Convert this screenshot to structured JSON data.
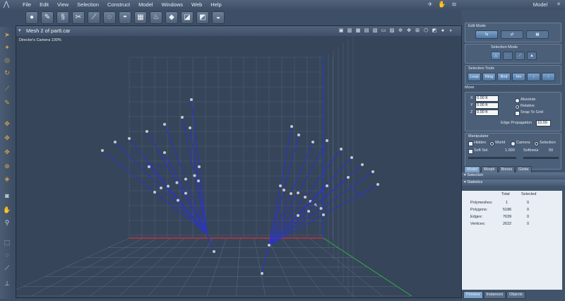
{
  "menubar": {
    "items": [
      "File",
      "Edit",
      "View",
      "Selection",
      "Construct",
      "Model",
      "Windows",
      "Web",
      "Help"
    ]
  },
  "toolbar": {
    "tools": [
      {
        "icon": "sphere-icon",
        "glyph": "●"
      },
      {
        "icon": "pen-icon",
        "glyph": "✎"
      },
      {
        "icon": "spiral-icon",
        "glyph": "§"
      },
      {
        "icon": "scissors-icon",
        "glyph": "✂"
      },
      {
        "icon": "knife-icon",
        "glyph": "⟋"
      },
      {
        "icon": "lasso-icon",
        "glyph": "◌"
      },
      {
        "icon": "dome-icon",
        "glyph": "◓"
      },
      {
        "icon": "grid-icon",
        "glyph": "▦"
      },
      {
        "icon": "flame-icon",
        "glyph": "♨"
      },
      {
        "icon": "shape-icon",
        "glyph": "◆"
      },
      {
        "icon": "box-icon",
        "glyph": "◪"
      },
      {
        "icon": "cube-icon",
        "glyph": "◩"
      },
      {
        "icon": "bowl-icon",
        "glyph": "◒"
      }
    ]
  },
  "room": {
    "title": "Model"
  },
  "viewport": {
    "title": "Mesh 2 of par8.car",
    "camera_label": "Director's Camera 100%"
  },
  "right_panel": {
    "edit_mode": {
      "label": "Edit Mode"
    },
    "selection_mode": {
      "label": "Selection Mode"
    },
    "selection_tools": {
      "label": "Selection Tools",
      "buttons": [
        "Loop",
        "Ring",
        "Bnd",
        "Inv"
      ]
    },
    "move": {
      "label": "Move",
      "x_label": "X",
      "x_value": "0.00 ft",
      "y_label": "Y",
      "y_value": "0.00 ft",
      "z_label": "Z",
      "z_value": "0.00 ft",
      "absolute": "Absolute",
      "relative": "Relative",
      "snap": "Snap To Grid",
      "edge_prop_label": "Edge Propagation",
      "edge_prop_value": "10.00"
    },
    "manipulator": {
      "label": "Manipulator",
      "hidden": "Hidden",
      "world": "World",
      "camera": "Camera",
      "selection": "Selection",
      "soft_sel": "Soft Sel.",
      "soft_val": "1.000",
      "softness": "Softness",
      "softness_val": "50"
    },
    "tabs": [
      "Model",
      "Morph",
      "Bones",
      "Globs"
    ],
    "sections": [
      "Selection",
      "Statistics"
    ],
    "stats": {
      "col_total": "Total",
      "col_selected": "Selected",
      "rows": [
        {
          "label": "Polymeshes:",
          "total": "1",
          "selected": "0"
        },
        {
          "label": "Polygons:",
          "total": "5186",
          "selected": "0"
        },
        {
          "label": "Edges:",
          "total": "7639",
          "selected": "0"
        },
        {
          "label": "Vertices:",
          "total": "2622",
          "selected": "0"
        }
      ]
    },
    "bottom_tabs": [
      "Preview",
      "Instances",
      "Objects"
    ]
  }
}
